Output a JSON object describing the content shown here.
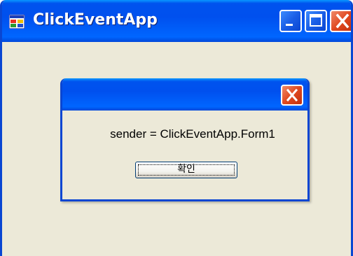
{
  "main_window": {
    "title": "ClickEventApp",
    "icon": "app-window-icon",
    "controls": {
      "minimize": "minimize-icon",
      "maximize": "maximize-icon",
      "close": "close-icon"
    }
  },
  "dialog": {
    "title": "",
    "message": "sender = ClickEventApp.Form1",
    "ok_label": "확인",
    "close_icon": "close-icon"
  },
  "colors": {
    "titlebar_blue": "#0053ee",
    "close_red": "#e0481e",
    "window_face": "#ece9d8"
  }
}
